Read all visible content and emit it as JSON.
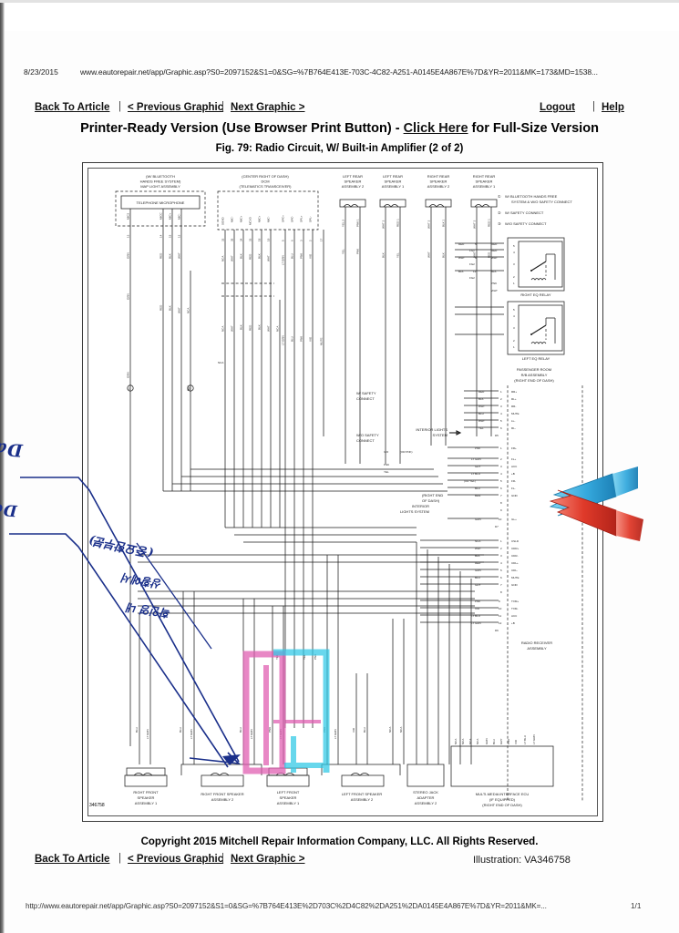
{
  "browser": {
    "print_date": "8/23/2015",
    "print_url": "www.eautorepair.net/app/Graphic.asp?S0=2097152&S1=0&SG=%7B764E413E-703C-4C82-A251-A0145E4A867E%7D&YR=2011&MK=173&MD=1538...",
    "footer_url": "http://www.eautorepair.net/app/Graphic.asp?S0=2097152&S1=0&SG=%7B764E413E%2D703C%2D4C82%2DA251%2DA0145E4A867E%7D&YR=2011&MK=...",
    "page_indicator": "1/1"
  },
  "nav": {
    "back_to_article": "Back To Article",
    "previous_graphic": "< Previous Graphic",
    "next_graphic": "Next Graphic >",
    "logout": "Logout",
    "help": "Help",
    "separator": "|"
  },
  "headings": {
    "printer_ready_pre": "Printer-Ready Version (Use Browser Print Button) - ",
    "click_here": "Click Here",
    "printer_ready_post": " for Full-Size Version",
    "figure_caption": "Fig. 79: Radio Circuit, W/ Built-in Amplifier (2 of 2)"
  },
  "footer": {
    "copyright": "Copyright 2015 Mitchell Repair Information Company, LLC.  All Rights Reserved.",
    "illustration": "Illustration: VA346758"
  },
  "diagram": {
    "illustration_number": "346758",
    "notes": [
      {
        "marker": "①",
        "line1": "W/ BLUETOOTH HANDS FREE",
        "line2": "SYSTEM & W/O SAFETY CONNECT"
      },
      {
        "marker": "②",
        "line1": "W/ SAFETY CONNECT",
        "line2": ""
      },
      {
        "marker": "③",
        "line1": "W/O SAFETY CONNECT",
        "line2": ""
      }
    ],
    "components": {
      "telephone_microphone": {
        "header1": "(W/ BLUETOOTH",
        "header2": "HANDS FREE SYSTEM)",
        "header3": "MAP LIGHT ASSEMBLY",
        "box_label": "TELEPHONE MICROPHONE",
        "pin_names": [
          "MIC2",
          "MICC",
          "MIC+",
          "MIC-"
        ],
        "pin_numbers": [
          "13",
          "14",
          "15",
          "12"
        ],
        "wire_colors": [
          "GRN",
          "RED",
          "BLK",
          "WHT"
        ]
      },
      "dcm": {
        "header1": "(CENTER RIGHT OF DASH)",
        "header2": "DCM",
        "header3": "(TELEMATICS TRANSCEIVER)",
        "pin_names": [
          "SGND",
          "MIC-",
          "MIC+",
          "MCVD",
          "MIC+",
          "MIC-",
          "SPC+",
          "SPC-",
          "SPL+",
          "SPL-",
          "MUTE"
        ],
        "pin_numbers": [
          "32",
          "35",
          "34",
          "33",
          "18",
          "19",
          "5",
          "6",
          "3",
          "2",
          "17"
        ],
        "wire_colors": [
          "NCA",
          "WHT",
          "BLK",
          "RED",
          "BLK",
          "WHT",
          "LT GRN",
          "BLU",
          "PNK",
          "VIO"
        ]
      },
      "speakers_rear": [
        {
          "label1": "LEFT REAR",
          "label2": "SPEAKER",
          "label3": "ASSEMBLY 2",
          "pins": [
            "2",
            "4"
          ],
          "colors": [
            "YEL",
            "PNK"
          ]
        },
        {
          "label1": "LEFT REAR",
          "label2": "SPEAKER",
          "label3": "ASSEMBLY 1",
          "pins": [
            "1",
            "3"
          ],
          "colors": [
            "WHT",
            "BLK"
          ]
        },
        {
          "label1": "RIGHT REAR",
          "label2": "SPEAKER",
          "label3": "ASSEMBLY 2",
          "pins": [
            "2",
            "4"
          ],
          "colors": [
            "WHT",
            "BLK"
          ]
        },
        {
          "label1": "RIGHT REAR",
          "label2": "SPEAKER",
          "label3": "ASSEMBLY 1",
          "pins": [
            "1",
            "3"
          ],
          "colors": [
            "WHT",
            "RED"
          ]
        }
      ],
      "right_eq_relay": "RIGHT EQ RELAY",
      "left_eq_relay": "LEFT EQ RELAY",
      "junction_block": {
        "line1": "PASSENGER ROOM",
        "line2": "R/B ASSEMBLY",
        "line3": "(RIGHT END OF DASH)",
        "pins": [
          "1",
          "2",
          "3",
          "4",
          "5",
          "6"
        ],
        "pin_names": [
          "RR+",
          "RL+",
          "RR-",
          "MUTE",
          "LL-",
          "RL-"
        ],
        "colors": [
          "RED",
          "BLK",
          "WHT",
          "BLU",
          "WHT",
          "YEL"
        ],
        "connector": "D5"
      },
      "radio_receiver": {
        "line1": "RADIO RECEIVER",
        "line2": "ASSEMBLY",
        "connector_d7": {
          "code": "D7",
          "pins": [
            "1",
            "2",
            "3",
            "4",
            "5",
            "6",
            "7",
            "8",
            "9",
            "10"
          ],
          "pin_names": [
            "FR+",
            "FL+",
            "ACC",
            "+B",
            "FR-",
            "FL-",
            "GND",
            "",
            "",
            "ILL+"
          ],
          "colors": [
            "PNK",
            "LT GRN",
            "GRY",
            "LT BLU",
            "(OR YEL)",
            "BLU",
            "BRN",
            "",
            "",
            "GRN"
          ]
        },
        "connector_d6": {
          "code": "D6",
          "pins": [
            "1",
            "2",
            "3",
            "4",
            "5",
            "6",
            "7",
            "8",
            "9",
            "10",
            "11",
            "12"
          ],
          "pin_names": [
            "CSLD",
            "CDR+",
            "CDR-",
            "CDL+",
            "CDL-",
            "MUTE",
            "GND",
            "",
            "TXM+",
            "TXM-",
            "ACC",
            "+B"
          ],
          "colors": [
            "NCA",
            "WHT",
            "BLK",
            "RED",
            "GRN",
            "BLU",
            "GRY",
            "",
            "PNK",
            "VIO",
            "LT BLU",
            "LT GRN"
          ]
        }
      },
      "interior_lights_system": "INTERIOR LIGHTS SYSTEM",
      "wo_safety_connect_note": "W/O SAFETY CONNECT",
      "right_end_of_dash_note1": "(RIGHT END",
      "right_end_of_dash_note2": "OF DASH)",
      "bottom_components": [
        {
          "line1": "RIGHT FRONT",
          "line2": "SPEAKER",
          "line3": "ASSEMBLY 1"
        },
        {
          "line1": "RIGHT FRONT SPEAKER",
          "line2": "ASSEMBLY 2",
          "line3": ""
        },
        {
          "line1": "LEFT FRONT",
          "line2": "SPEAKER",
          "line3": "ASSEMBLY 1"
        },
        {
          "line1": "LEFT FRONT SPEAKER",
          "line2": "ASSEMBLY 2",
          "line3": ""
        },
        {
          "line1": "STEREO JACK",
          "line2": "ADAPTER",
          "line3": "ASSEMBLY 2"
        }
      ],
      "mmi_ecu": {
        "line1": "MULTI-MEDIA INTERFACE ECU",
        "line2": "(IF EQUIPPED)",
        "line3": "(RIGHT END OF DASH)"
      }
    }
  },
  "annotations": {
    "handwritten": [
      {
        "text": "Dash",
        "id": "hand-dash"
      },
      {
        "text": "Door",
        "id": "hand-door"
      },
      {
        "text": "(중요한부분)",
        "id": "hand-note1"
      },
      {
        "text": "상황에서",
        "id": "hand-note2"
      },
      {
        "text": "확인영 내",
        "id": "hand-note3"
      }
    ],
    "arrows": [
      {
        "name": "blue-arrow",
        "color": "#2f9ad6",
        "points_at": "ACC"
      },
      {
        "name": "red-arrow",
        "color": "#e03a2a",
        "points_at": "+B"
      }
    ],
    "highlighter": [
      {
        "name": "magenta-highlight",
        "color": "#e05ab0"
      },
      {
        "name": "cyan-highlight",
        "color": "#2ec8e6"
      }
    ],
    "pen_lines": {
      "color": "#1a2f8a"
    }
  },
  "colors": {
    "accent_blue": "#2f9ad6",
    "accent_red": "#e03a2a",
    "magenta": "#e05ab0",
    "cyan": "#2ec8e6",
    "ink": "#1a2f8a",
    "line": "#2a2a2a"
  }
}
